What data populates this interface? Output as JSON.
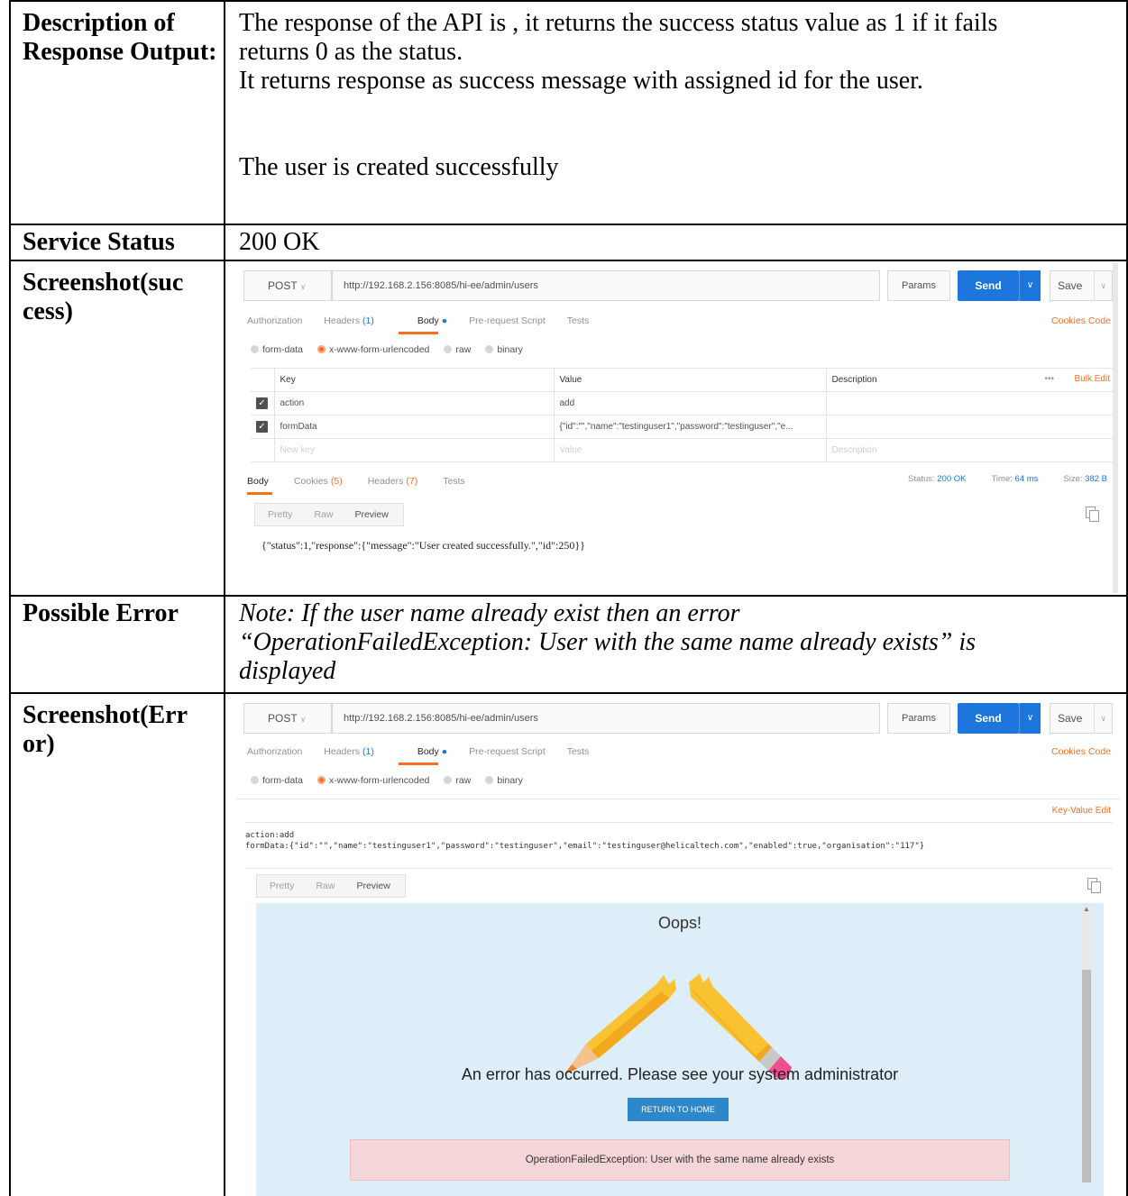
{
  "rows": {
    "description": {
      "label": "Description of Response Output:",
      "line1": "The response of the API is , it returns the success status value as 1 if it fails",
      "line2": "returns 0 as the status.",
      "line3": "It returns response as success message with assigned id for the user.",
      "line4": "The user is created successfully"
    },
    "service_status": {
      "label": "Service Status",
      "value": "200 OK"
    },
    "screenshot_success": {
      "label_line1": "Screenshot(suc",
      "label_line2": "cess)"
    },
    "possible_error": {
      "label": "Possible Error",
      "line1": "Note: If the user name already exist then an error",
      "line2": "“OperationFailedException: User with the same name already exists” is",
      "line3": "displayed"
    },
    "screenshot_error": {
      "label_line1": "Screenshot(Err",
      "label_line2": "or)"
    }
  },
  "postman": {
    "method": "POST",
    "url": "http://192.168.2.156:8085/hi-ee/admin/users",
    "params": "Params",
    "send": "Send",
    "save": "Save",
    "tabs": {
      "authorization": "Authorization",
      "headers": "Headers",
      "headers_count": "(1)",
      "body": "Body",
      "prerequest": "Pre-request Script",
      "tests": "Tests"
    },
    "links": {
      "cookies": "Cookies",
      "code": "Code"
    },
    "body_modes": {
      "form_data": "form-data",
      "urlencoded": "x-www-form-urlencoded",
      "raw": "raw",
      "binary": "binary"
    },
    "kv": {
      "col_key": "Key",
      "col_value": "Value",
      "col_desc": "Description",
      "dots": "•••",
      "bulk_edit": "Bulk Edit",
      "rows": [
        {
          "key": "action",
          "value": "add"
        },
        {
          "key": "formData",
          "value": "{\"id\":\"\",\"name\":\"testinguser1\",\"password\":\"testinguser\",\"e..."
        }
      ],
      "new_key": "New key",
      "new_value": "Value",
      "new_desc": "Description"
    },
    "response": {
      "tabs": {
        "body": "Body",
        "cookies": "Cookies",
        "cookies_count": "(5)",
        "headers": "Headers",
        "headers_count": "(7)",
        "tests": "Tests"
      },
      "status_label": "Status:",
      "status_value": "200 OK",
      "time_label": "Time:",
      "time_value": "64 ms",
      "size_label": "Size:",
      "size_value": "382 B",
      "format": {
        "pretty": "Pretty",
        "raw": "Raw",
        "preview": "Preview"
      },
      "body": "{\"status\":1,\"response\":{\"message\":\"User created successfully.\",\"id\":250}}"
    },
    "error_view": {
      "key_value_edit": "Key-Value Edit",
      "raw_line1": "action:add",
      "raw_line2": "formData:{\"id\":\"\",\"name\":\"testinguser1\",\"password\":\"testinguser\",\"email\":\"testinguser@helicaltech.com\",\"enabled\":true,\"organisation\":\"117\"}",
      "oops": "Oops!",
      "error_message": "An error has occurred. Please see your system administrator",
      "return_home": "RETURN TO HOME",
      "exception": "OperationFailedException: User with the same name already exists"
    }
  },
  "colors": {
    "accent": "#f47023",
    "send": "#1d76dc",
    "preview_bg": "#ddeef8",
    "error_bg": "#f5d6d8"
  }
}
